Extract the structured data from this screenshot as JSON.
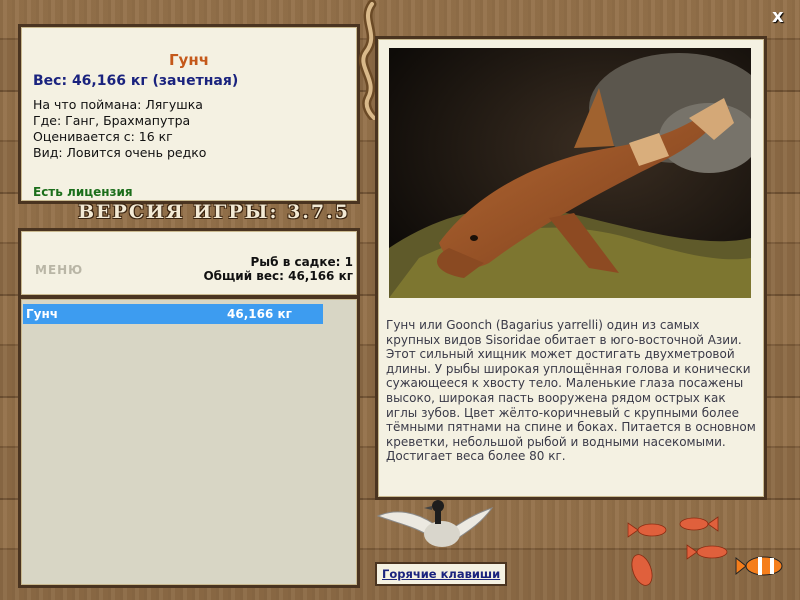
{
  "window": {
    "close_label": "x"
  },
  "fish": {
    "name": "Гунч",
    "weight_line": "Вес: 46,166 кг (зачетная)",
    "bait": "На что поймана: Лягушка",
    "location": "Где: Ганг, Брахмапутра",
    "rated_from": "Оценивается с: 16 кг",
    "rarity": "Вид: Ловится очень редко",
    "license": "Есть лицензия"
  },
  "version_text": "ВЕРСИЯ ИГРЫ: 3.7.5",
  "stats": {
    "menu_label": "МЕНЮ",
    "fish_count": "Рыб в садке: 1",
    "total_weight": "Общий вес: 46,166 кг"
  },
  "catch_list": [
    {
      "name": "Гунч",
      "weight": "46,166 кг"
    }
  ],
  "description": "Гунч или Goonch (Bagarius yarrelli) один из самых крупных видов Sisoridae обитает в юго-восточной Азии. Этот сильный хищник может достигать двухметровой длины. У рыбы широкая уплощённая голова и конически сужающееся к хвосту тело. Маленькие глаза посажены высоко, широкая пасть вооружена рядом острых как иглы зубов. Цвет жёлто-коричневый с крупными более тёмными пятнами на спине и боках. Питается в основном креветки, небольшой рыбой и водными насекомыми. Достигает веса более 80 кг.",
  "hotkeys_label": "Горячие клавиши",
  "colors": {
    "accent": "#c4581a",
    "weight": "#1a237e",
    "license": "#1b6e1b",
    "selected_row": "#3d9cf0"
  }
}
